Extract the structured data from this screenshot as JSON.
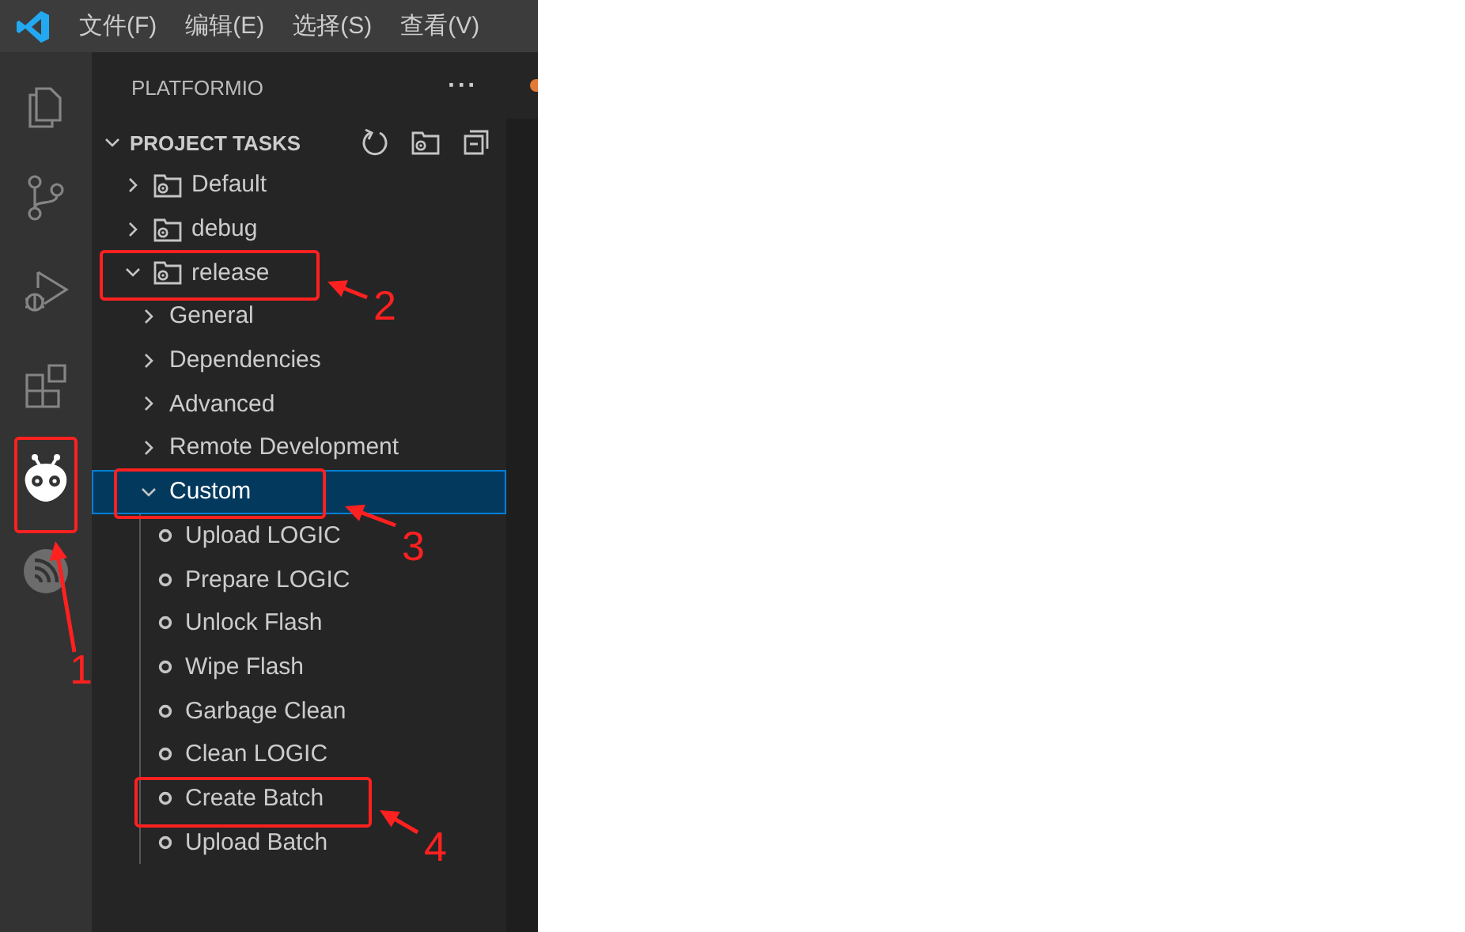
{
  "menu_bar": {
    "items": [
      "文件(F)",
      "编辑(E)",
      "选择(S)",
      "查看(V)"
    ]
  },
  "activity_bar": [
    {
      "kind": "explorer",
      "selected": false
    },
    {
      "kind": "source_control",
      "selected": false
    },
    {
      "kind": "run_debug",
      "selected": false
    },
    {
      "kind": "extensions",
      "selected": false
    },
    {
      "kind": "platformio",
      "selected": true
    },
    {
      "kind": "espressif",
      "selected": false
    }
  ],
  "sidebar": {
    "title": "PLATFORMIO",
    "more": "···",
    "section": {
      "title": "PROJECT TASKS",
      "expanded": true,
      "items": [
        {
          "kind": "env",
          "label": "Default",
          "expanded": false,
          "selected": false
        },
        {
          "kind": "env",
          "label": "debug",
          "expanded": false,
          "selected": false
        },
        {
          "kind": "env",
          "label": "release",
          "expanded": true,
          "selected": false,
          "children": [
            {
              "kind": "group",
              "label": "General",
              "expanded": false,
              "selected": false
            },
            {
              "kind": "group",
              "label": "Dependencies",
              "expanded": false,
              "selected": false
            },
            {
              "kind": "group",
              "label": "Advanced",
              "expanded": false,
              "selected": false
            },
            {
              "kind": "group",
              "label": "Remote Development",
              "expanded": false,
              "selected": false
            },
            {
              "kind": "group",
              "label": "Custom",
              "expanded": true,
              "selected": true,
              "children": [
                {
                  "kind": "task",
                  "label": "Upload LOGIC",
                  "selected": false
                },
                {
                  "kind": "task",
                  "label": "Prepare LOGIC",
                  "selected": false
                },
                {
                  "kind": "task",
                  "label": "Unlock Flash",
                  "selected": false
                },
                {
                  "kind": "task",
                  "label": "Wipe Flash",
                  "selected": false
                },
                {
                  "kind": "task",
                  "label": "Garbage Clean",
                  "selected": false
                },
                {
                  "kind": "task",
                  "label": "Clean LOGIC",
                  "selected": false
                },
                {
                  "kind": "task",
                  "label": "Create Batch",
                  "selected": false
                },
                {
                  "kind": "task",
                  "label": "Upload Batch",
                  "selected": false
                }
              ]
            }
          ]
        }
      ]
    }
  },
  "annotations": [
    {
      "label": "1"
    },
    {
      "label": "2"
    },
    {
      "label": "3"
    },
    {
      "label": "4"
    }
  ]
}
